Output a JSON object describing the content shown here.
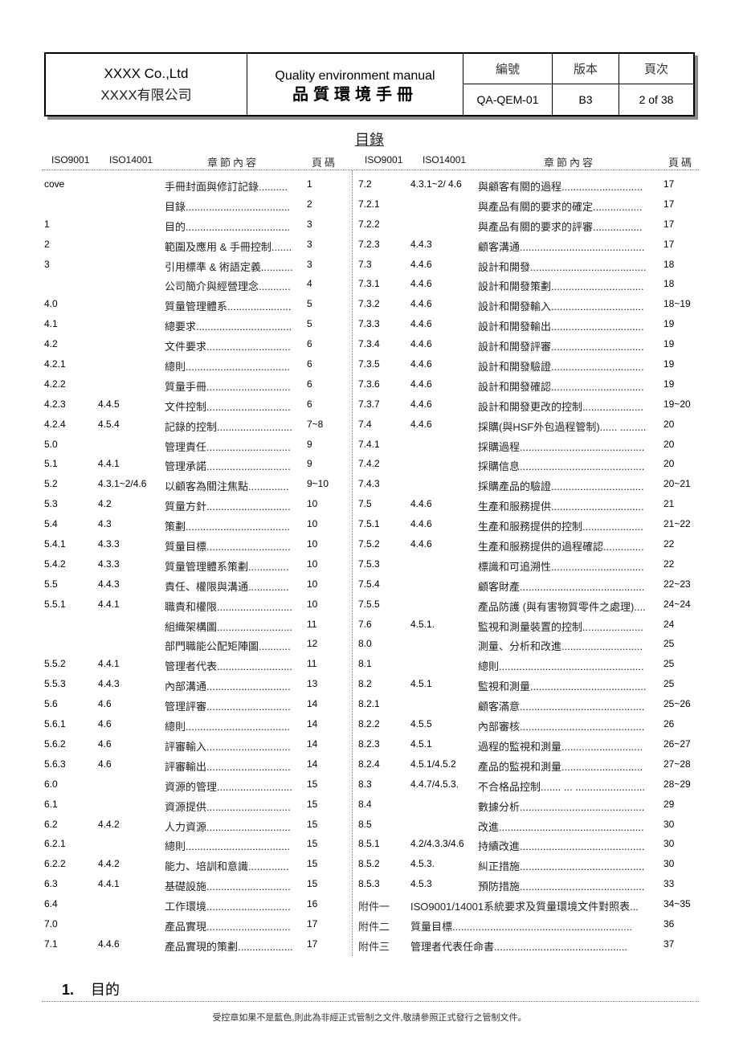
{
  "header": {
    "company_en": "XXXX Co.,Ltd",
    "company_zh": "XXXX有限公司",
    "title_en": "Quality environment manual",
    "title_zh": "品質環境手冊",
    "labels": {
      "doc_no": "編號",
      "version": "版本",
      "page": "頁次"
    },
    "values": {
      "doc_no": "QA-QEM-01",
      "version": "B3",
      "page": "2 of 38"
    }
  },
  "toc": {
    "title": "目錄",
    "columns": {
      "iso9001": "ISO9001",
      "iso14001": "ISO14001",
      "content": "章節內容",
      "page": "頁碼"
    },
    "left": [
      {
        "iso9001": "cove",
        "iso14001": "",
        "title": "手冊封面與修訂記錄..........",
        "page": "1"
      },
      {
        "iso9001": "",
        "iso14001": "",
        "title": "目錄....................................",
        "page": "2"
      },
      {
        "iso9001": "1",
        "iso14001": "",
        "title": "目的....................................",
        "page": "3"
      },
      {
        "iso9001": "2",
        "iso14001": "",
        "title": "範圍及應用 & 手冊控制.......",
        "page": "3"
      },
      {
        "iso9001": "3",
        "iso14001": "",
        "title": "引用標準 & 術語定義...........",
        "page": "3"
      },
      {
        "iso9001": "",
        "iso14001": "",
        "title": "公司簡介與經營理念...........",
        "page": "4"
      },
      {
        "iso9001": "4.0",
        "iso14001": "",
        "title": "質量管理體系......................",
        "page": "5"
      },
      {
        "iso9001": "4.1",
        "iso14001": "",
        "title": "總要求.................................",
        "page": "5"
      },
      {
        "iso9001": "4.2",
        "iso14001": "",
        "title": "文件要求.............................",
        "page": "6"
      },
      {
        "iso9001": "4.2.1",
        "iso14001": "",
        "title": "總則....................................",
        "page": "6"
      },
      {
        "iso9001": "4.2.2",
        "iso14001": "",
        "title": "質量手冊.............................",
        "page": "6"
      },
      {
        "iso9001": "4.2.3",
        "iso14001": "4.4.5",
        "title": "文件控制.............................",
        "page": "6"
      },
      {
        "iso9001": "4.2.4",
        "iso14001": "4.5.4",
        "title": "記錄的控制..........................",
        "page": "7~8"
      },
      {
        "iso9001": "5.0",
        "iso14001": "",
        "title": "管理責任.............................",
        "page": "9"
      },
      {
        "iso9001": "5.1",
        "iso14001": "4.4.1",
        "title": "管理承諾.............................",
        "page": "9"
      },
      {
        "iso9001": "5.2",
        "iso14001": "4.3.1~2/4.6",
        "title": "以顧客為關注焦點..............",
        "page": "9~10"
      },
      {
        "iso9001": "5.3",
        "iso14001": "4.2",
        "title": "質量方針.............................",
        "page": "10"
      },
      {
        "iso9001": "5.4",
        "iso14001": "4.3",
        "title": "策劃....................................",
        "page": "10"
      },
      {
        "iso9001": "5.4.1",
        "iso14001": "4.3.3",
        "title": "質量目標.............................",
        "page": "10"
      },
      {
        "iso9001": "5.4.2",
        "iso14001": "4.3.3",
        "title": "質量管理體系策劃..............",
        "page": "10"
      },
      {
        "iso9001": "5.5",
        "iso14001": "4.4.3",
        "title": "責任、權限與溝通..............",
        "page": "10"
      },
      {
        "iso9001": "5.5.1",
        "iso14001": "4.4.1",
        "title": "職責和權限..........................",
        "page": "10"
      },
      {
        "iso9001": "",
        "iso14001": "",
        "title": "組織架構圖..........................",
        "page": "11"
      },
      {
        "iso9001": "",
        "iso14001": "",
        "title": "部門職能公配矩陣圖...........",
        "page": "12"
      },
      {
        "iso9001": "5.5.2",
        "iso14001": "4.4.1",
        "title": "管理者代表..........................",
        "page": "11"
      },
      {
        "iso9001": "5.5.3",
        "iso14001": "4.4.3",
        "title": "內部溝通.............................",
        "page": "13"
      },
      {
        "iso9001": "5.6",
        "iso14001": "4.6",
        "title": "管理評審.............................",
        "page": "14"
      },
      {
        "iso9001": "5.6.1",
        "iso14001": "4.6",
        "title": "總則....................................",
        "page": "14"
      },
      {
        "iso9001": "5.6.2",
        "iso14001": "4.6",
        "title": "評審輸入.............................",
        "page": "14"
      },
      {
        "iso9001": "5.6.3",
        "iso14001": "4.6",
        "title": "評審輸出.............................",
        "page": "14"
      },
      {
        "iso9001": "6.0",
        "iso14001": "",
        "title": "資源的管理..........................",
        "page": "15"
      },
      {
        "iso9001": "6.1",
        "iso14001": "",
        "title": "資源提供.............................",
        "page": "15"
      },
      {
        "iso9001": "6.2",
        "iso14001": "4.4.2",
        "title": "人力資源.............................",
        "page": "15"
      },
      {
        "iso9001": "6.2.1",
        "iso14001": "",
        "title": "總則....................................",
        "page": "15"
      },
      {
        "iso9001": "6.2.2",
        "iso14001": "4.4.2",
        "title": "能力、培訓和意識..............",
        "page": "15"
      },
      {
        "iso9001": "6.3",
        "iso14001": "4.4.1",
        "title": "基礎設施.............................",
        "page": "15"
      },
      {
        "iso9001": "6.4",
        "iso14001": "",
        "title": "工作環境.............................",
        "page": "16"
      },
      {
        "iso9001": "7.0",
        "iso14001": "",
        "title": "產品實現.............................",
        "page": "17"
      },
      {
        "iso9001": "7.1",
        "iso14001": "4.4.6",
        "title": "產品實現的策劃...................",
        "page": "17"
      }
    ],
    "right": [
      {
        "iso9001": "7.2",
        "iso14001": "4.3.1~2/ 4.6",
        "title": "與顧客有關的過程............................",
        "page": "17"
      },
      {
        "iso9001": "7.2.1",
        "iso14001": "",
        "title": "與產品有關的要求的確定.................",
        "page": "17"
      },
      {
        "iso9001": "7.2.2",
        "iso14001": "",
        "title": "與產品有關的要求的評審.................",
        "page": "17"
      },
      {
        "iso9001": "7.2.3",
        "iso14001": "4.4.3",
        "title": "顧客溝通...........................................",
        "page": "17"
      },
      {
        "iso9001": "7.3",
        "iso14001": "4.4.6",
        "title": "設計和開發........................................",
        "page": "18"
      },
      {
        "iso9001": "7.3.1",
        "iso14001": "4.4.6",
        "title": "設計和開發策劃................................",
        "page": "18"
      },
      {
        "iso9001": "7.3.2",
        "iso14001": "4.4.6",
        "title": "設計和開發輸入................................",
        "page": "18~19"
      },
      {
        "iso9001": "7.3.3",
        "iso14001": "4.4.6",
        "title": "設計和開發輸出................................",
        "page": "19"
      },
      {
        "iso9001": "7.3.4",
        "iso14001": "4.4.6",
        "title": "設計和開發評審................................",
        "page": "19"
      },
      {
        "iso9001": "7.3.5",
        "iso14001": "4.4.6",
        "title": "設計和開發驗證................................",
        "page": "19"
      },
      {
        "iso9001": "7.3.6",
        "iso14001": "4.4.6",
        "title": "設計和開發確認................................",
        "page": "19"
      },
      {
        "iso9001": "7.3.7",
        "iso14001": "4.4.6",
        "title": "設計和開發更改的控制.....................",
        "page": "19~20"
      },
      {
        "iso9001": "7.4",
        "iso14001": "4.4.6",
        "title": "採購(與HSF外包過程管制)...... .........",
        "page": "20"
      },
      {
        "iso9001": "7.4.1",
        "iso14001": "",
        "title": "採購過程...........................................",
        "page": "20"
      },
      {
        "iso9001": "7.4.2",
        "iso14001": "",
        "title": "採購信息...........................................",
        "page": "20"
      },
      {
        "iso9001": "7.4.3",
        "iso14001": "",
        "title": "採購產品的驗證................................",
        "page": "20~21"
      },
      {
        "iso9001": "7.5",
        "iso14001": "4.4.6",
        "title": "生產和服務提供................................",
        "page": "21"
      },
      {
        "iso9001": "7.5.1",
        "iso14001": "4.4.6",
        "title": "生產和服務提供的控制.....................",
        "page": "21~22"
      },
      {
        "iso9001": "7.5.2",
        "iso14001": "4.4.6",
        "title": "生產和服務提供的過程確認..............",
        "page": "22"
      },
      {
        "iso9001": "7.5.3",
        "iso14001": "",
        "title": "標識和可追溯性................................",
        "page": "22"
      },
      {
        "iso9001": "7.5.4",
        "iso14001": "",
        "title": "顧客財產...........................................",
        "page": "22~23"
      },
      {
        "iso9001": "7.5.5",
        "iso14001": "",
        "title": "產品防護 (與有害物質零件之處理)....",
        "page": "24~24"
      },
      {
        "iso9001": "7.6",
        "iso14001": "4.5.1.",
        "title": "監視和測量裝置的控制.....................",
        "page": "24"
      },
      {
        "iso9001": "8.0",
        "iso14001": "",
        "title": "測量、分析和改進............................",
        "page": "25"
      },
      {
        "iso9001": "8.1",
        "iso14001": "",
        "title": "總則..................................................",
        "page": "25"
      },
      {
        "iso9001": "8.2",
        "iso14001": "4.5.1",
        "title": "監視和測量........................................",
        "page": "25"
      },
      {
        "iso9001": "8.2.1",
        "iso14001": "",
        "title": "顧客滿意...........................................",
        "page": "25~26"
      },
      {
        "iso9001": "8.2.2",
        "iso14001": "4.5.5",
        "title": "內部審核...........................................",
        "page": "26"
      },
      {
        "iso9001": "8.2.3",
        "iso14001": "4.5.1",
        "title": "過程的監視和測量............................",
        "page": "26~27"
      },
      {
        "iso9001": "8.2.4",
        "iso14001": "4.5.1/4.5.2",
        "title": "產品的監視和測量............................",
        "page": "27~28"
      },
      {
        "iso9001": "8.3",
        "iso14001": "4.4.7/4.5.3.",
        "title": "不合格品控制....... ... ........................",
        "page": "28~29"
      },
      {
        "iso9001": "8.4",
        "iso14001": "",
        "title": "數據分析...........................................",
        "page": "29"
      },
      {
        "iso9001": "8.5",
        "iso14001": "",
        "title": "改進..................................................",
        "page": "30"
      },
      {
        "iso9001": "8.5.1",
        "iso14001": "4.2/4.3.3/4.6",
        "title": "持續改進...........................................",
        "page": "30"
      },
      {
        "iso9001": "8.5.2",
        "iso14001": "4.5.3.",
        "title": "糾正措施...........................................",
        "page": "30"
      },
      {
        "iso9001": "8.5.3",
        "iso14001": "4.5.3",
        "title": "預防措施...........................................",
        "page": "33"
      }
    ],
    "annex": [
      {
        "label": "附件一",
        "title": "ISO9001/14001系統要求及質量環境文件對照表...",
        "page": "34~35"
      },
      {
        "label": "附件二",
        "title": "質量目標..............................................................",
        "page": "36"
      },
      {
        "label": "附件三",
        "title": "管理者代表任命書..............................................",
        "page": "37"
      }
    ]
  },
  "section": {
    "number": "1.",
    "title": "目的"
  },
  "footer": {
    "notice": "受控章如果不是藍色,則此為非經正式管制之文件,敬請參照正式發行之管制文件。"
  }
}
